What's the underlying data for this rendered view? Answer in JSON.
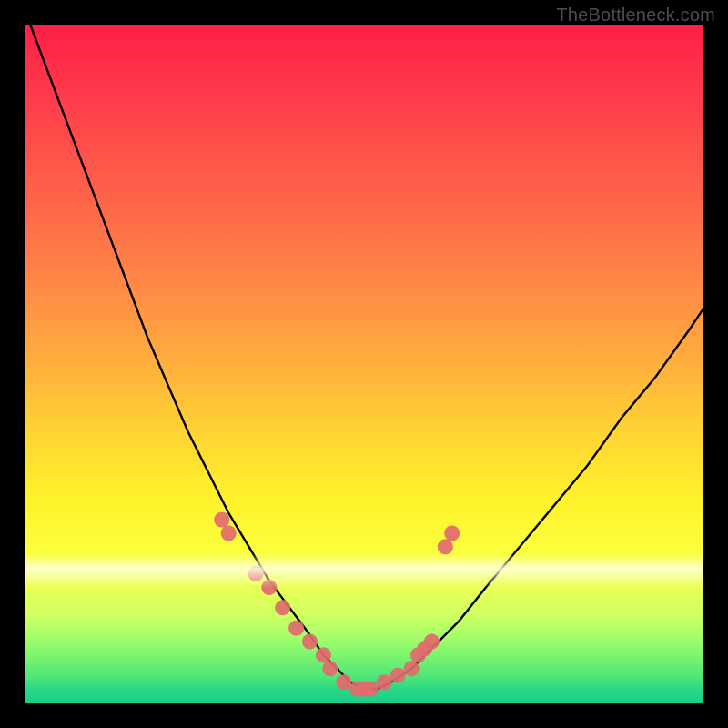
{
  "watermark": "TheBottleneck.com",
  "chart_data": {
    "type": "line",
    "title": "",
    "xlabel": "",
    "ylabel": "",
    "xlim": [
      0,
      100
    ],
    "ylim": [
      0,
      100
    ],
    "curve": {
      "x": [
        0,
        3,
        6,
        9,
        12,
        15,
        18,
        21,
        24,
        27,
        30,
        33,
        36,
        39,
        42,
        44,
        46,
        48,
        50,
        52,
        54,
        57,
        60,
        64,
        68,
        73,
        78,
        83,
        88,
        93,
        98,
        100
      ],
      "y": [
        102,
        94,
        86,
        78,
        70,
        62,
        54,
        47,
        40,
        34,
        28,
        23,
        18,
        14,
        10,
        7,
        5,
        3,
        2,
        2,
        3,
        5,
        8,
        12,
        17,
        23,
        29,
        35,
        42,
        48,
        55,
        58
      ]
    },
    "markers": {
      "x": [
        29,
        30,
        34,
        36,
        38,
        40,
        42,
        44,
        45,
        47,
        49,
        50,
        51,
        53,
        55,
        57,
        58,
        59,
        60,
        62,
        63
      ],
      "y": [
        27,
        25,
        19,
        17,
        14,
        11,
        9,
        7,
        5,
        3,
        2,
        2,
        2,
        3,
        4,
        5,
        7,
        8,
        9,
        23,
        25
      ]
    },
    "marker_color": "#e26a6e",
    "curve_color": "#000000"
  }
}
